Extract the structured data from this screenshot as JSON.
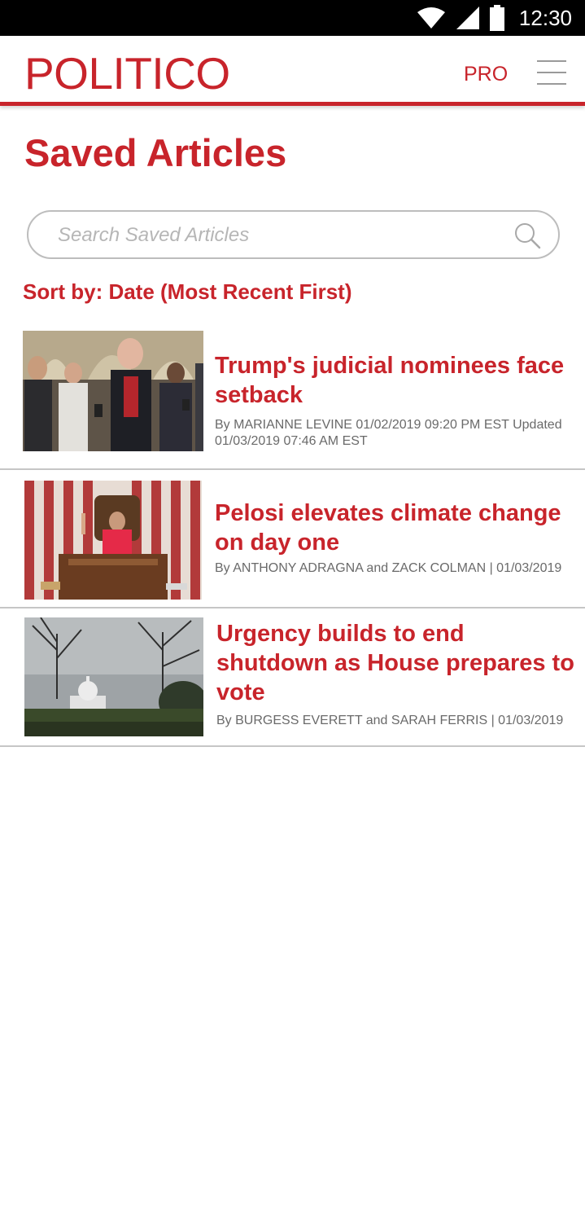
{
  "status_bar": {
    "time": "12:30",
    "icons": [
      "wifi-icon",
      "cellular-signal-icon",
      "battery-icon"
    ]
  },
  "header": {
    "logo": "POLITICO",
    "pro_label": "PRO",
    "menu_icon": "hamburger-menu-icon"
  },
  "page": {
    "title": "Saved Articles"
  },
  "search": {
    "placeholder": "Search Saved Articles",
    "value": "",
    "icon": "search-icon"
  },
  "sort": {
    "label": "Sort by: Date (Most Recent First)"
  },
  "articles": [
    {
      "title": "Trump's judicial nominees face setback",
      "meta": "By MARIANNE LEVINE 01/02/2019 09:20 PM EST Updated 01/03/2019 07:46 AM EST",
      "image": "photo-reporters-crowd"
    },
    {
      "title": "Pelosi elevates climate change on day one",
      "meta": "By ANTHONY ADRAGNA and ZACK COLMAN | 01/03/2019",
      "image": "photo-speaker-podium-flag"
    },
    {
      "title": "Urgency builds to end shutdown as House prepares to vote",
      "meta": "By BURGESS EVERETT and SARAH FERRIS | 01/03/2019",
      "image": "photo-capitol-dome-trees"
    }
  ],
  "colors": {
    "brand_red": "#c8242b",
    "meta_gray": "#6a6a6a",
    "divider": "#c6c6c6"
  }
}
